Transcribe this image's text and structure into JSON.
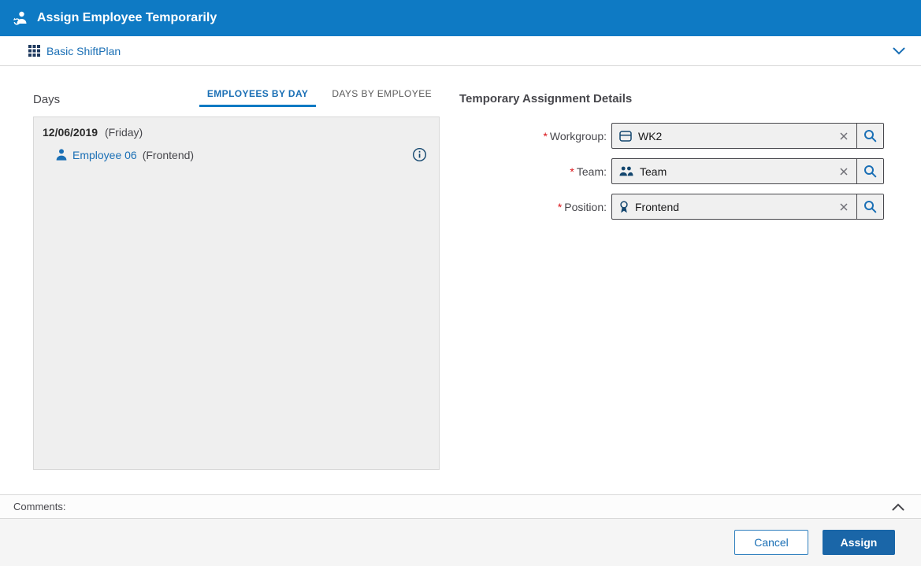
{
  "colors": {
    "header_bg": "#0e7ac4",
    "accent_blue": "#1a6fb5",
    "primary_button": "#1a66a8",
    "required_red": "#da1217",
    "panel_bg": "#efefef"
  },
  "header": {
    "title": "Assign Employee Temporarily",
    "icon": "assign-employee-icon"
  },
  "plan_bar": {
    "label": "Basic ShiftPlan",
    "icon": "grid-icon",
    "collapse_icon": "chevron-down-icon"
  },
  "days": {
    "title": "Days",
    "tabs": [
      {
        "label": "EMPLOYEES BY DAY",
        "active": true
      },
      {
        "label": "DAYS BY EMPLOYEE",
        "active": false
      }
    ],
    "entry": {
      "date": "12/06/2019",
      "day_name": "(Friday)",
      "employee_name": "Employee 06",
      "employee_role": "(Frontend)",
      "employee_icon": "user-icon",
      "info_icon": "info-icon"
    }
  },
  "details": {
    "title": "Temporary Assignment Details",
    "required_marker": "*",
    "fields": [
      {
        "label": "Workgroup:",
        "value": "WK2",
        "icon": "workgroup-icon"
      },
      {
        "label": "Team:",
        "value": "Team",
        "icon": "team-icon"
      },
      {
        "label": "Position:",
        "value": "Frontend",
        "icon": "position-icon"
      }
    ]
  },
  "comments": {
    "label": "Comments:",
    "collapse_icon": "chevron-up-icon"
  },
  "footer": {
    "cancel_label": "Cancel",
    "assign_label": "Assign"
  }
}
